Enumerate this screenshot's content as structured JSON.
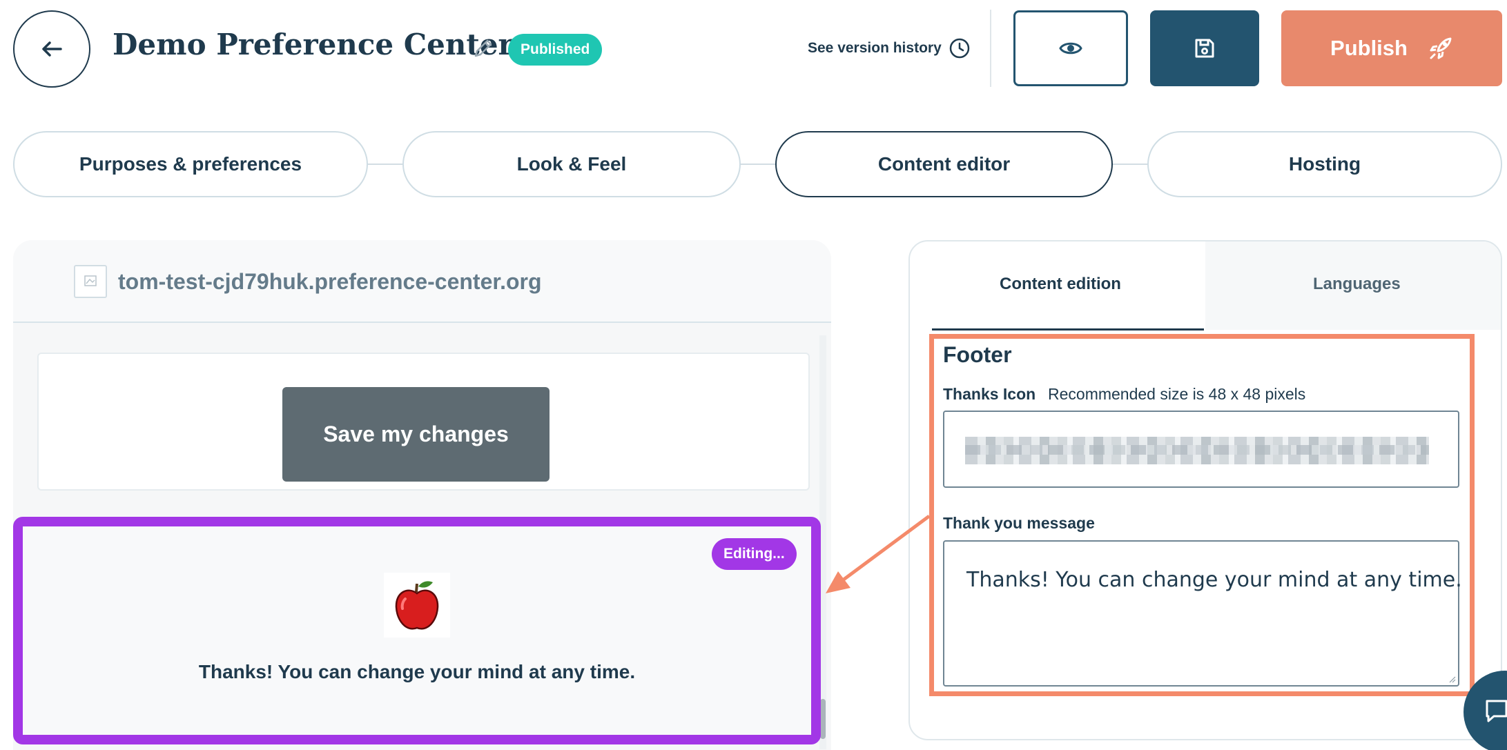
{
  "header": {
    "title": "Demo Preference Center",
    "status_badge": "Published",
    "version_history": "See version history",
    "publish_label": "Publish"
  },
  "steps": [
    {
      "label": "Purposes & preferences",
      "active": false
    },
    {
      "label": "Look & Feel",
      "active": false
    },
    {
      "label": "Content editor",
      "active": true
    },
    {
      "label": "Hosting",
      "active": false
    }
  ],
  "preview": {
    "url": "tom-test-cjd79huk.preference-center.org",
    "save_button": "Save my changes",
    "editing_badge": "Editing...",
    "thanks_text": "Thanks! You can change your mind at any time."
  },
  "editor": {
    "tabs": [
      {
        "label": "Content edition",
        "active": true
      },
      {
        "label": "Languages",
        "active": false
      }
    ],
    "section_title": "Footer",
    "thanks_icon_label": "Thanks Icon",
    "thanks_icon_hint": "Recommended size is 48 x 48 pixels",
    "thank_you_label": "Thank you message",
    "thank_you_value": "Thanks! You can change your mind at any time."
  },
  "colors": {
    "primary": "#23546f",
    "publish": "#e8896c",
    "published_badge": "#1fc6b2",
    "editing_highlight": "#a237e6",
    "annotation": "#f48a6a"
  },
  "icons": [
    "back-arrow-icon",
    "pencil-icon",
    "clock-icon",
    "eye-icon",
    "floppy-disk-icon",
    "rocket-icon",
    "favicon-icon",
    "apple-icon",
    "chat-icon"
  ]
}
